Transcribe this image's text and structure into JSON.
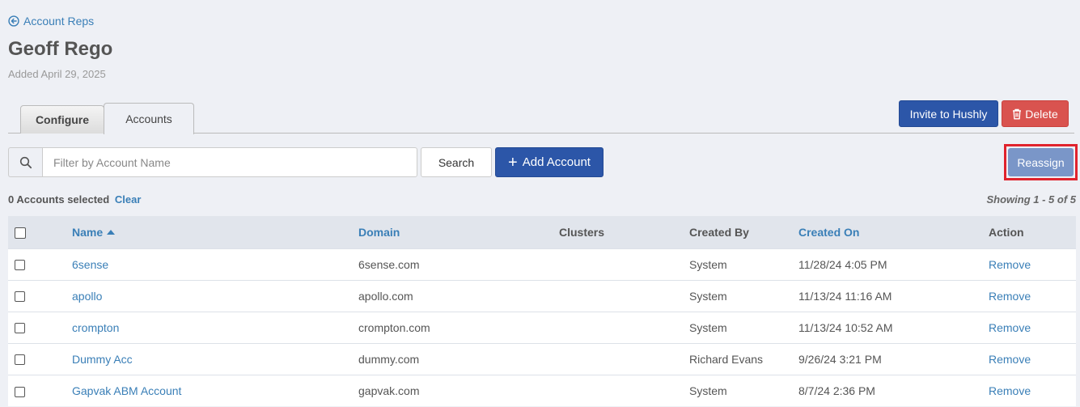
{
  "header": {
    "back_label": "Account Reps",
    "title": "Geoff Rego",
    "added": "Added April 29, 2025"
  },
  "tabs": [
    {
      "label": "Configure",
      "active": false
    },
    {
      "label": "Accounts",
      "active": true
    }
  ],
  "actions": {
    "invite_label": "Invite to Hushly",
    "delete_label": "Delete"
  },
  "toolbar": {
    "filter_placeholder": "Filter by Account Name",
    "filter_value": "",
    "search_label": "Search",
    "add_label": "Add Account",
    "reassign_label": "Reassign"
  },
  "selection": {
    "selected_text": "0 Accounts selected",
    "clear_label": "Clear",
    "showing_text": "Showing 1 - 5 of 5"
  },
  "table": {
    "columns": [
      "Name",
      "Domain",
      "Clusters",
      "Created By",
      "Created On",
      "Action"
    ],
    "rows": [
      {
        "name": "6sense",
        "domain": "6sense.com",
        "clusters": "",
        "created_by": "System",
        "created_on": "11/28/24 4:05 PM",
        "action": "Remove"
      },
      {
        "name": "apollo",
        "domain": "apollo.com",
        "clusters": "",
        "created_by": "System",
        "created_on": "11/13/24 11:16 AM",
        "action": "Remove"
      },
      {
        "name": "crompton",
        "domain": "crompton.com",
        "clusters": "",
        "created_by": "System",
        "created_on": "11/13/24 10:52 AM",
        "action": "Remove"
      },
      {
        "name": "Dummy Acc",
        "domain": "dummy.com",
        "clusters": "",
        "created_by": "Richard Evans",
        "created_on": "9/26/24 3:21 PM",
        "action": "Remove"
      },
      {
        "name": "Gapvak ABM Account",
        "domain": "gapvak.com",
        "clusters": "",
        "created_by": "System",
        "created_on": "8/7/24 2:36 PM",
        "action": "Remove"
      }
    ]
  },
  "colors": {
    "primary": "#2c56a8",
    "danger": "#d9534f",
    "link": "#3a7fb7",
    "reassign": "#7a96c8",
    "highlight": "#e0232d"
  }
}
